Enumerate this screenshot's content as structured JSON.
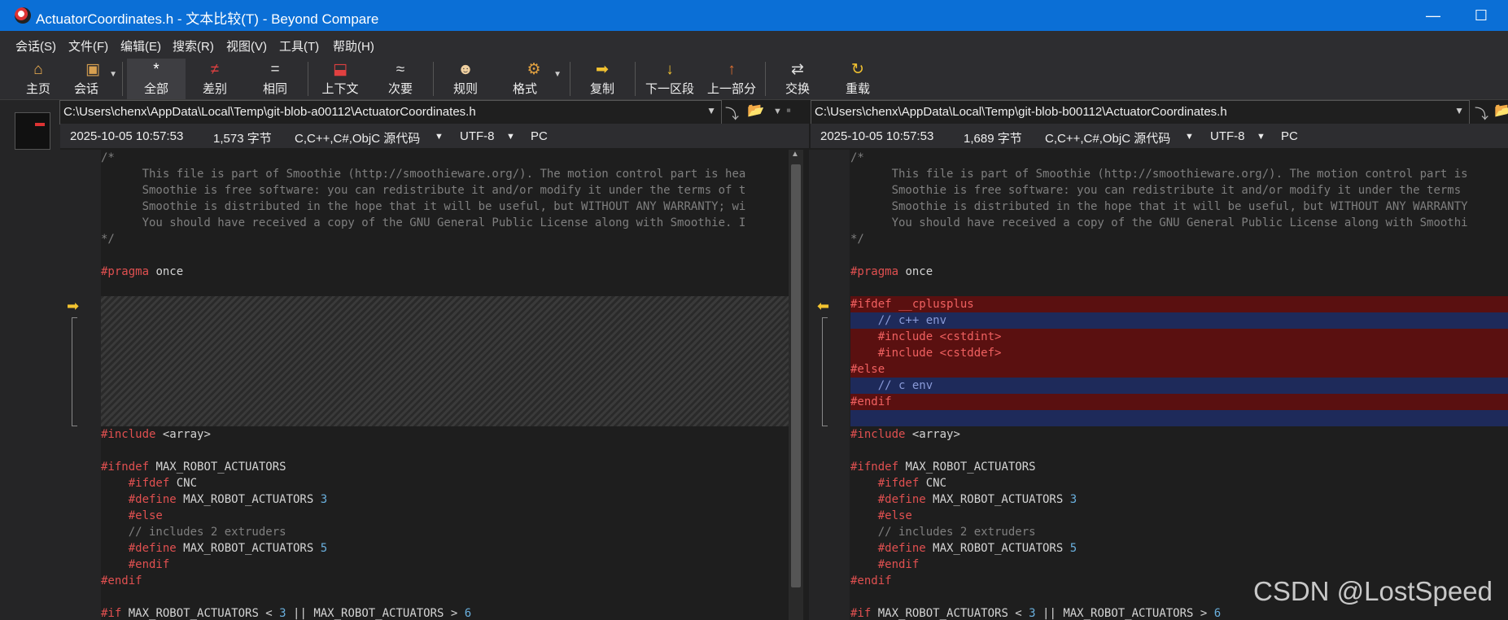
{
  "window": {
    "title": "ActuatorCoordinates.h - 文本比较(T) - Beyond Compare",
    "minimize_glyph": "—",
    "maximize_glyph": "☐"
  },
  "menu": [
    "会话(S)",
    "文件(F)",
    "编辑(E)",
    "搜索(R)",
    "视图(V)",
    "工具(T)",
    "帮助(H)"
  ],
  "toolbar": {
    "home": "主页",
    "session": "会话",
    "all": "全部",
    "diffs": "差别",
    "same": "相同",
    "context": "上下文",
    "minor": "次要",
    "rules": "规则",
    "format": "格式",
    "copy": "复制",
    "next_section": "下一区段",
    "prev_section": "上一部分",
    "swap": "交换",
    "reload": "重载"
  },
  "left": {
    "path": "C:\\Users\\chenx\\AppData\\Local\\Temp\\git-blob-a00112\\ActuatorCoordinates.h",
    "date": "2025-10-05 10:57:53",
    "size": "1,573 字节",
    "format": "C,C++,C#,ObjC 源代码",
    "encoding": "UTF-8",
    "lineend": "PC",
    "code": {
      "c0": "/*",
      "c1": "      This file is part of Smoothie (http://smoothieware.org/). The motion control part is hea",
      "c2": "      Smoothie is free software: you can redistribute it and/or modify it under the terms of t",
      "c3": "      Smoothie is distributed in the hope that it will be useful, but WITHOUT ANY WARRANTY; wi",
      "c4": "      You should have received a copy of the GNU General Public License along with Smoothie. I",
      "c5": "*/",
      "pragma_kw": "#pragma",
      "pragma_arg": " once",
      "inc_kw": "#include",
      "inc_arg": " <array>",
      "ifndef_kw": "#ifndef",
      "ifndef_arg": " MAX_ROBOT_ACTUATORS",
      "ifdef_kw": "    #ifdef",
      "ifdef_arg": " CNC",
      "def1_kw": "    #define",
      "def1_arg": " MAX_ROBOT_ACTUATORS ",
      "def1_num": "3",
      "else_kw": "    #else",
      "cmt": "    // includes 2 extruders",
      "def2_kw": "    #define",
      "def2_arg": " MAX_ROBOT_ACTUATORS ",
      "def2_num": "5",
      "endif1_kw": "    #endif",
      "endif2_kw": "#endif",
      "if_kw": "#if",
      "if_arg1": " MAX_ROBOT_ACTUATORS < ",
      "if_num1": "3",
      "if_arg2": " || MAX_ROBOT_ACTUATORS > ",
      "if_num2": "6"
    }
  },
  "right": {
    "path": "C:\\Users\\chenx\\AppData\\Local\\Temp\\git-blob-b00112\\ActuatorCoordinates.h",
    "date": "2025-10-05 10:57:53",
    "size": "1,689 字节",
    "format": "C,C++,C#,ObjC 源代码",
    "encoding": "UTF-8",
    "lineend": "PC",
    "code": {
      "c0": "/*",
      "c1": "      This file is part of Smoothie (http://smoothieware.org/). The motion control part is",
      "c2": "      Smoothie is free software: you can redistribute it and/or modify it under the terms",
      "c3": "      Smoothie is distributed in the hope that it will be useful, but WITHOUT ANY WARRANTY",
      "c4": "      You should have received a copy of the GNU General Public License along with Smoothi",
      "c5": "*/",
      "pragma_kw": "#pragma",
      "pragma_arg": " once",
      "ins1_kw": "#ifdef",
      "ins1_arg": " __cplusplus",
      "ins2": "    // c++ env",
      "ins3": "    #include <cstdint>",
      "ins4": "    #include <cstddef>",
      "ins5": "#else",
      "ins6": "    // c env",
      "ins7": "#endif",
      "inc_kw": "#include",
      "inc_arg": " <array>",
      "ifndef_kw": "#ifndef",
      "ifndef_arg": " MAX_ROBOT_ACTUATORS",
      "ifdef_kw": "    #ifdef",
      "ifdef_arg": " CNC",
      "def1_kw": "    #define",
      "def1_arg": " MAX_ROBOT_ACTUATORS ",
      "def1_num": "3",
      "else_kw": "    #else",
      "cmt": "    // includes 2 extruders",
      "def2_kw": "    #define",
      "def2_arg": " MAX_ROBOT_ACTUATORS ",
      "def2_num": "5",
      "endif1_kw": "    #endif",
      "endif2_kw": "#endif",
      "if_kw": "#if",
      "if_arg1": " MAX_ROBOT_ACTUATORS < ",
      "if_num1": "3",
      "if_arg2": " || MAX_ROBOT_ACTUATORS > ",
      "if_num2": "6"
    }
  },
  "watermark": "CSDN @LostSpeed"
}
